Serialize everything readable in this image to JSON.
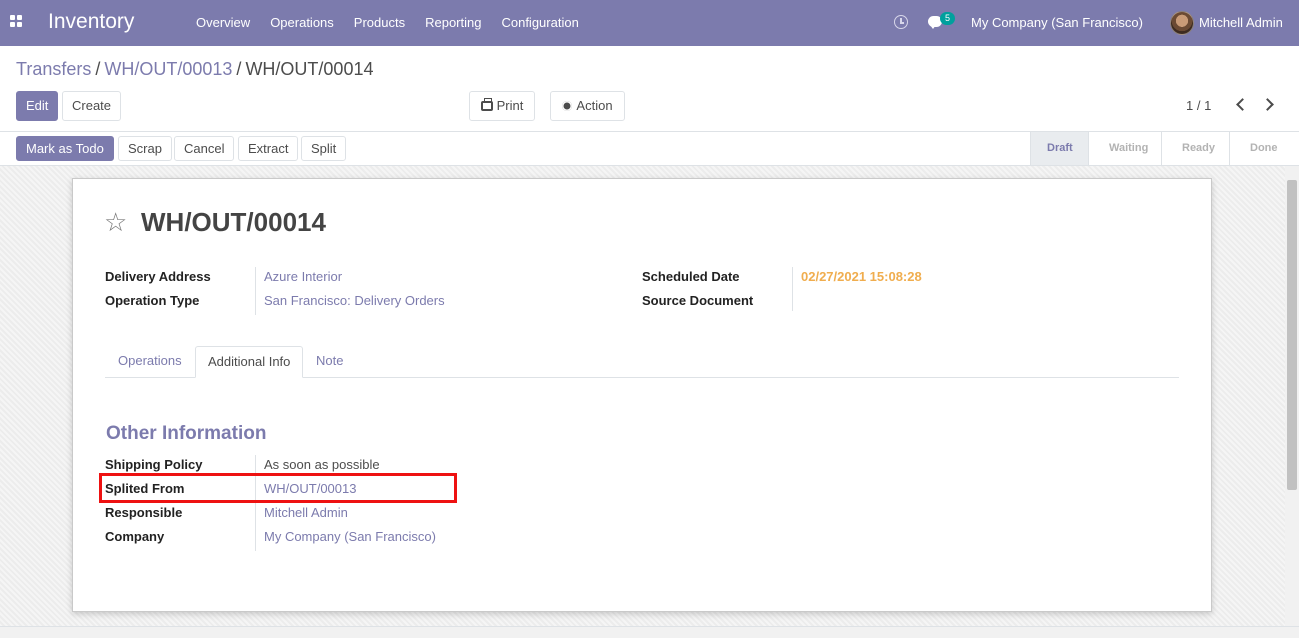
{
  "navbar": {
    "app_name": "Inventory",
    "menu": [
      "Overview",
      "Operations",
      "Products",
      "Reporting",
      "Configuration"
    ],
    "chat_count": "5",
    "company": "My Company (San Francisco)",
    "user": "Mitchell Admin",
    "color": "#7c7bad"
  },
  "breadcrumb": {
    "items": [
      "Transfers",
      "WH/OUT/00013",
      "WH/OUT/00014"
    ],
    "separator": "/"
  },
  "toolbar": {
    "edit": "Edit",
    "create": "Create",
    "print": "Print",
    "action": "Action",
    "pager": "1 / 1"
  },
  "statusbar": {
    "buttons": [
      "Mark as Todo",
      "Scrap",
      "Cancel",
      "Extract",
      "Split"
    ],
    "stages": [
      "Draft",
      "Waiting",
      "Ready",
      "Done"
    ],
    "active_stage": "Draft"
  },
  "record": {
    "title": "WH/OUT/00014",
    "left_fields": [
      {
        "label": "Delivery Address",
        "value": "Azure Interior"
      },
      {
        "label": "Operation Type",
        "value": "San Francisco: Delivery Orders"
      }
    ],
    "right_fields": [
      {
        "label": "Scheduled Date",
        "value": "02/27/2021 15:08:28"
      },
      {
        "label": "Source Document",
        "value": ""
      }
    ]
  },
  "tabs": [
    "Operations",
    "Additional Info",
    "Note"
  ],
  "active_tab": "Additional Info",
  "other_info": {
    "title": "Other Information",
    "fields": [
      {
        "label": "Shipping Policy",
        "value": "As soon as possible"
      },
      {
        "label": "Splited From",
        "value": "WH/OUT/00013"
      },
      {
        "label": "Responsible",
        "value": "Mitchell Admin"
      },
      {
        "label": "Company",
        "value": "My Company (San Francisco)"
      }
    ]
  }
}
